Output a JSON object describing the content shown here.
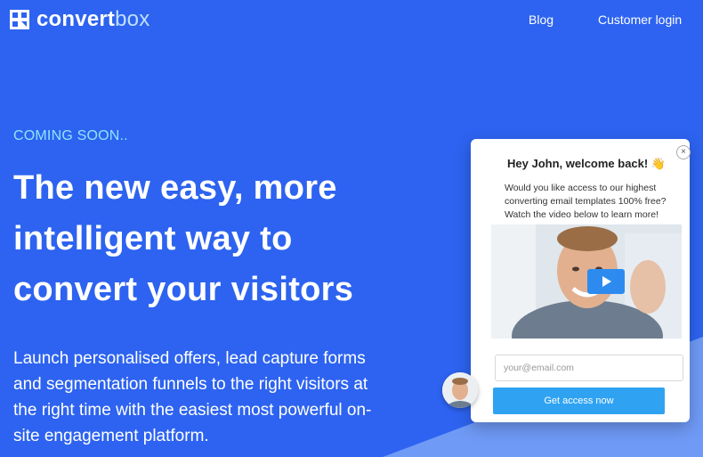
{
  "header": {
    "logo_part1": "convert",
    "logo_part2": "box",
    "nav": [
      {
        "label": "Blog"
      },
      {
        "label": "Customer login"
      }
    ]
  },
  "hero": {
    "eyebrow": "COMING SOON..",
    "title_lines": [
      "The new easy, more",
      "intelligent way to",
      "convert your visitors"
    ],
    "subtitle_lines": [
      "Launch personalised offers, lead capture forms",
      "and segmentation funnels to the right visitors at",
      "the right time with the easiest most powerful on-",
      "site engagement platform."
    ]
  },
  "popup": {
    "close_glyph": "×",
    "title": "Hey John, welcome back! 👋",
    "text_lines": [
      "Would you like access to our highest",
      "converting email templates 100% free?",
      "Watch the video below to learn more!"
    ],
    "email_placeholder": "your@email.com",
    "cta_label": "Get access now"
  },
  "colors": {
    "background": "#2d63f0",
    "accent_text": "#8fe5ff",
    "cta": "#2fa3f2"
  }
}
